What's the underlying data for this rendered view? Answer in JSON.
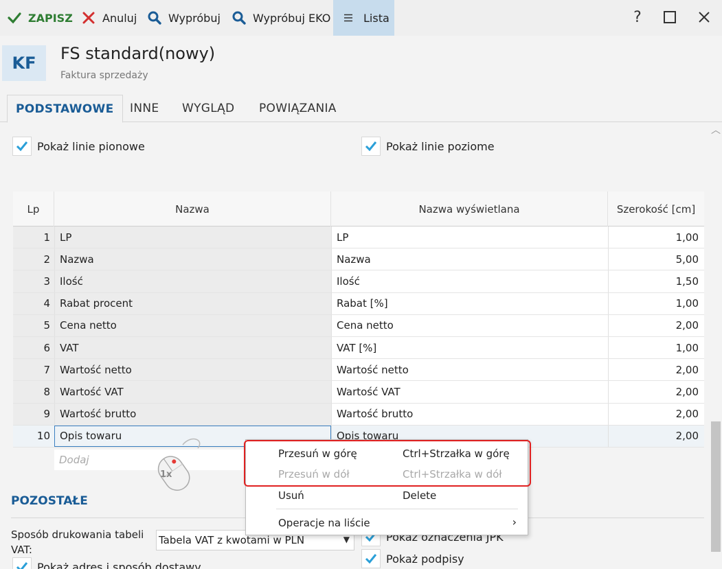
{
  "toolbar": {
    "save_label": "ZAPISZ",
    "cancel_label": "Anuluj",
    "try_label": "Wypróbuj",
    "try_eko_label": "Wypróbuj EKO",
    "list_label": "Lista",
    "help_glyph": "?"
  },
  "header": {
    "badge": "KF",
    "title": "FS standard(nowy)",
    "subtitle": "Faktura sprzedaży"
  },
  "tabs": [
    {
      "label": "PODSTAWOWE",
      "active": true
    },
    {
      "label": "INNE",
      "active": false
    },
    {
      "label": "WYGLĄD",
      "active": false
    },
    {
      "label": "POWIĄZANIA",
      "active": false
    }
  ],
  "options": {
    "vertical_lines_label": "Pokaż linie pionowe",
    "horizontal_lines_label": "Pokaż linie poziome"
  },
  "table": {
    "headers": [
      "Lp",
      "Nazwa",
      "Nazwa wyświetlana",
      "Szerokość [cm]"
    ],
    "rows": [
      {
        "lp": "1",
        "name": "LP",
        "display": "LP",
        "width": "1,00"
      },
      {
        "lp": "2",
        "name": "Nazwa",
        "display": "Nazwa",
        "width": "5,00"
      },
      {
        "lp": "3",
        "name": "Ilość",
        "display": "Ilość",
        "width": "1,50"
      },
      {
        "lp": "4",
        "name": "Rabat procent",
        "display": "Rabat [%]",
        "width": "1,00"
      },
      {
        "lp": "5",
        "name": "Cena netto",
        "display": "Cena netto",
        "width": "2,00"
      },
      {
        "lp": "6",
        "name": "VAT",
        "display": "VAT [%]",
        "width": "1,00"
      },
      {
        "lp": "7",
        "name": "Wartość netto",
        "display": "Wartość netto",
        "width": "2,00"
      },
      {
        "lp": "8",
        "name": "Wartość VAT",
        "display": "Wartość VAT",
        "width": "2,00"
      },
      {
        "lp": "9",
        "name": "Wartość brutto",
        "display": "Wartość brutto",
        "width": "2,00"
      },
      {
        "lp": "10",
        "name": "Opis towaru",
        "display": "Opis towaru",
        "width": "2,00"
      }
    ],
    "add_placeholder": "Dodaj"
  },
  "context_menu": {
    "items": [
      {
        "label": "Przesuń w górę",
        "shortcut": "Ctrl+Strzałka w górę",
        "disabled": false
      },
      {
        "label": "Przesuń w dół",
        "shortcut": "Ctrl+Strzałka w dół",
        "disabled": true
      },
      {
        "label": "Usuń",
        "shortcut": "Delete",
        "disabled": false
      },
      {
        "label": "Operacje na liście",
        "shortcut": "",
        "disabled": false
      }
    ],
    "submenu_glyph": "›"
  },
  "mouse_hint": "1x",
  "other_section": {
    "title": "POZOSTAŁE",
    "vat_label": "Sposób drukowania tabeli VAT:",
    "vat_value": "Tabela VAT z kwotami w PLN",
    "show_address_label": "Pokaż adres i sposób dostawy",
    "show_jpk_label": "Pokaż oznaczenia JPK",
    "show_signatures_label": "Pokaż podpisy"
  },
  "colors": {
    "accent": "#1a5c96",
    "save_green": "#2e7d32",
    "cancel_red": "#d32f2f",
    "check_blue": "#2a9fd8",
    "highlight_red": "#e02020"
  }
}
